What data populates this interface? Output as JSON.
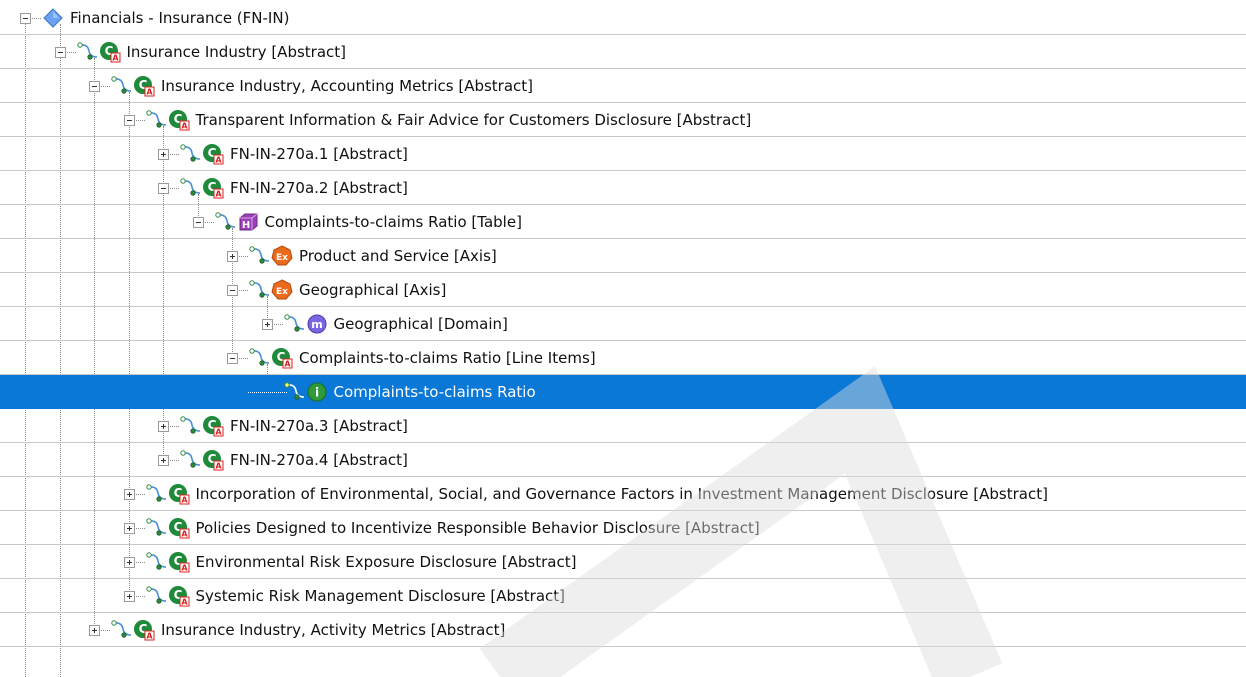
{
  "tree": {
    "rows": [
      {
        "label": "Financials - Insurance (FN-IN)",
        "level": 0,
        "toggle": "minus",
        "icon": "diamond-icon",
        "connector": false
      },
      {
        "label": "Insurance Industry [Abstract]",
        "level": 1,
        "toggle": "minus",
        "icon": "abstract-icon",
        "connector": true
      },
      {
        "label": "Insurance Industry, Accounting Metrics [Abstract]",
        "level": 2,
        "toggle": "minus",
        "icon": "abstract-icon",
        "connector": true
      },
      {
        "label": "Transparent Information & Fair Advice for Customers Disclosure [Abstract]",
        "level": 3,
        "toggle": "minus",
        "icon": "abstract-icon",
        "connector": true
      },
      {
        "label": "FN-IN-270a.1 [Abstract]",
        "level": 4,
        "toggle": "plus",
        "icon": "abstract-icon",
        "connector": true
      },
      {
        "label": "FN-IN-270a.2 [Abstract]",
        "level": 4,
        "toggle": "minus",
        "icon": "abstract-icon",
        "connector": true
      },
      {
        "label": "Complaints-to-claims Ratio [Table]",
        "level": 5,
        "toggle": "minus",
        "icon": "hypercube-icon",
        "connector": true
      },
      {
        "label": "Product and Service [Axis]",
        "level": 6,
        "toggle": "plus",
        "icon": "axis-icon",
        "connector": true
      },
      {
        "label": "Geographical [Axis]",
        "level": 6,
        "toggle": "minus",
        "icon": "axis-icon",
        "connector": true
      },
      {
        "label": "Geographical [Domain]",
        "level": 7,
        "toggle": "plus",
        "icon": "member-icon",
        "connector": true
      },
      {
        "label": "Complaints-to-claims Ratio [Line Items]",
        "level": 6,
        "toggle": "minus",
        "icon": "abstract-icon",
        "connector": true
      },
      {
        "label": "Complaints-to-claims Ratio",
        "level": 7,
        "toggle": "none",
        "icon": "item-icon",
        "connector": true,
        "selected": true
      },
      {
        "label": "FN-IN-270a.3 [Abstract]",
        "level": 4,
        "toggle": "plus",
        "icon": "abstract-icon",
        "connector": true
      },
      {
        "label": "FN-IN-270a.4 [Abstract]",
        "level": 4,
        "toggle": "plus",
        "icon": "abstract-icon",
        "connector": true
      },
      {
        "label": "Incorporation of Environmental, Social, and Governance Factors in Investment Management Disclosure [Abstract]",
        "level": 3,
        "toggle": "plus",
        "icon": "abstract-icon",
        "connector": true
      },
      {
        "label": "Policies Designed to Incentivize Responsible Behavior Disclosure [Abstract]",
        "level": 3,
        "toggle": "plus",
        "icon": "abstract-icon",
        "connector": true
      },
      {
        "label": "Environmental Risk Exposure Disclosure [Abstract]",
        "level": 3,
        "toggle": "plus",
        "icon": "abstract-icon",
        "connector": true
      },
      {
        "label": "Systemic Risk Management Disclosure [Abstract]",
        "level": 3,
        "toggle": "plus",
        "icon": "abstract-icon",
        "connector": true
      },
      {
        "label": "Insurance Industry, Activity Metrics [Abstract]",
        "level": 2,
        "toggle": "plus",
        "icon": "abstract-icon",
        "connector": true
      }
    ]
  },
  "colors": {
    "selection": "#0a78d6",
    "abstract_icon": "#1f8a3a",
    "abstract_badge": "#d82020",
    "hypercube_icon": "#9b3fb8",
    "axis_icon": "#ec6a1c",
    "member_icon": "#7a66e0",
    "item_icon": "#2f9a3a",
    "diamond_icon": "#6aa2f0",
    "connector": "#4a90d9"
  }
}
